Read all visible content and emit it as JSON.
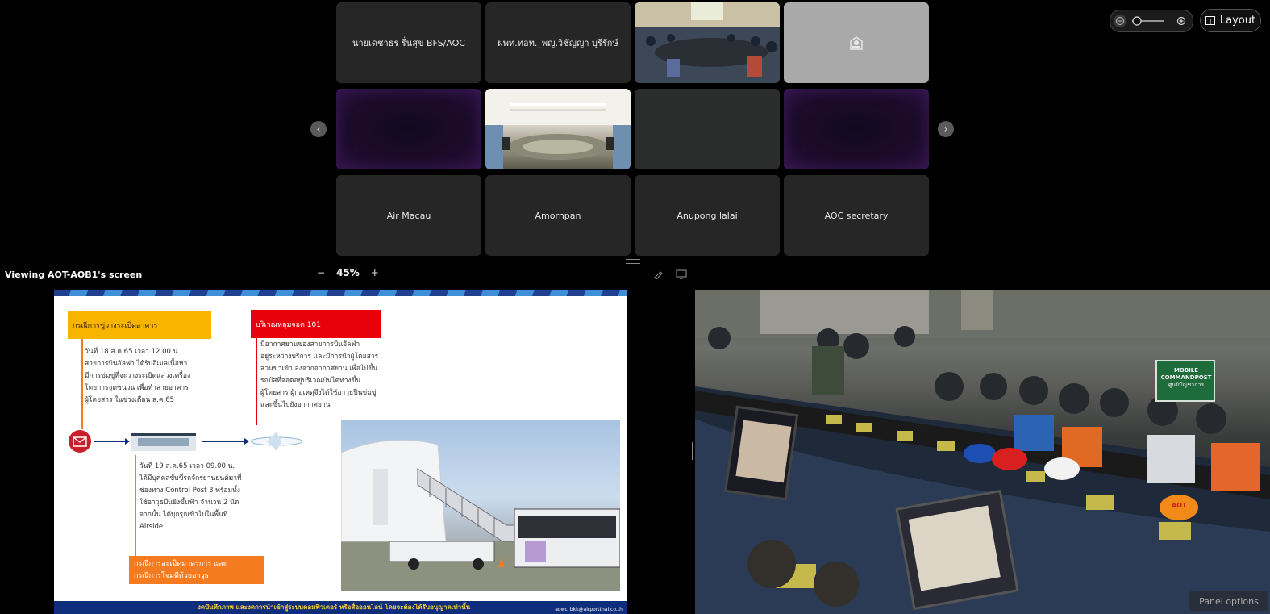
{
  "participants": [
    {
      "name": "นายเดชาธร รื่นสุข BFS/AOC",
      "kind": "name"
    },
    {
      "name": "ฝพท.ทอท._พญ.วิชัญญา บุรีรักษ์",
      "kind": "name"
    },
    {
      "name": "",
      "kind": "video-meeting-room"
    },
    {
      "name": "",
      "kind": "avatar"
    },
    {
      "name": "",
      "kind": "purple"
    },
    {
      "name": "",
      "kind": "video-conference-room"
    },
    {
      "name": "",
      "kind": "dark"
    },
    {
      "name": "",
      "kind": "purple"
    },
    {
      "name": "Air Macau",
      "kind": "name"
    },
    {
      "name": "Amornpan",
      "kind": "name"
    },
    {
      "name": "Anupong lalai",
      "kind": "name"
    },
    {
      "name": "AOC secretary",
      "kind": "name"
    }
  ],
  "toolbar": {
    "layout_label": "Layout",
    "zoom_out_icon": "zoom-out-icon",
    "zoom_in_icon": "zoom-in-icon"
  },
  "share": {
    "viewing_label": "Viewing AOT-AOB1's screen",
    "zoom_percent": "45%",
    "zoom_minus": "−",
    "zoom_plus": "+"
  },
  "slide": {
    "box1_title": "กรณีการขู่วางระเบิดอาคาร",
    "box1_text": [
      "วันที่ 18 ส.ค.65 เวลา 12.00 น.",
      "สายการบินอัลฟา ได้รับอีเมลเนื้อหา",
      "มีการข่มขู่ที่จะวางระเบิดแสวงเครื่อง",
      "โดยการจุดชนวน เพื่อทำลายอาคาร",
      "ผู้โดยสาร ในช่วงเดือน ส.ค.65"
    ],
    "box2_title": "บริเวณหลุมจอด 101",
    "box2_text": [
      "มีอากาศยานของสายการบินอัลฟ่า",
      "อยู่ระหว่างบริการ และมีการนำผู้โดยสาร",
      "ส่วนขาเข้า ลงจากอากาศยาน เพื่อไปขึ้น",
      "รถบัสที่จอดอยู่บริเวณบันไดทางขึ้น",
      "ผู้โดยสาร ผู้ก่อเหตุจึงได้ใช้อาวุธปืนข่มขู่",
      "และขึ้นไปยังอากาศยาน"
    ],
    "box3_text": [
      "วันที่ 19 ส.ค.65 เวลา 09.00 น.",
      "ได้มีบุคคลขับขี่รถจักรยานยนต์มาที่",
      "ช่องทาง Control Post 3 พร้อมทั้ง",
      "ใช้อาวุธปืนยิงขึ้นฟ้า จำนวน 2 นัด",
      "จากนั้น ได้บุกรุกเข้าไปในพื้นที่",
      "Airside"
    ],
    "box4_title": [
      "กรณีการละเมิดมาตรการ และ",
      "กรณีการโจมตีด้วยอาวุธ"
    ],
    "footer": "งดบันทึกภาพ และงดการนำเข้าสู่ระบบคอมพิวเตอร์ หรือสื่อออนไลน์ โดยจะต้องได้รับอนุญาตเท่านั้น",
    "footer_right": "aowc_bkk@airportthai.co.th"
  },
  "camera": {
    "sign_line1": "MOBILE COMMANDPOST",
    "sign_line2": "ศูนย์บัญชาการ",
    "helmet_label": "AOT"
  },
  "panel_options_label": "Panel options",
  "colors": {
    "tile_bg": "#262626",
    "accent_orange": "#f7b500",
    "accent_red": "#e8000b",
    "accent_orange2": "#f47b20"
  }
}
